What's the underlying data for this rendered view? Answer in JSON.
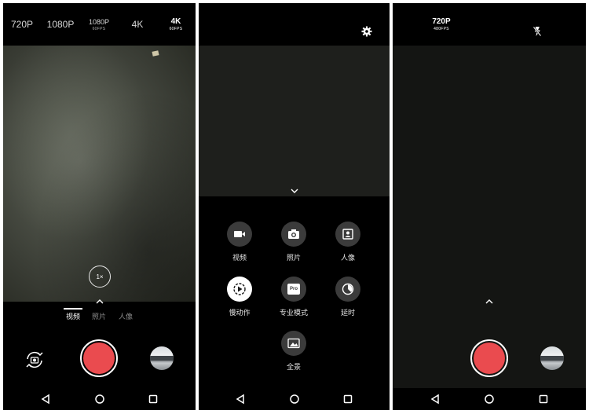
{
  "panel1": {
    "resolutions": [
      {
        "main": "720P",
        "sub": ""
      },
      {
        "main": "1080P",
        "sub": ""
      },
      {
        "main": "1080P",
        "sub": "60FPS"
      },
      {
        "main": "4K",
        "sub": ""
      },
      {
        "main": "4K",
        "sub": "60FPS"
      }
    ],
    "zoom_label": "1×",
    "modes": [
      "视频",
      "照片",
      "人像"
    ]
  },
  "panel2": {
    "modes": [
      {
        "label": "视频",
        "icon": "video-icon"
      },
      {
        "label": "照片",
        "icon": "camera-icon"
      },
      {
        "label": "人像",
        "icon": "portrait-icon"
      },
      {
        "label": "慢动作",
        "icon": "slow-motion-icon"
      },
      {
        "label": "专业模式",
        "icon": "pro-icon"
      },
      {
        "label": "延时",
        "icon": "timelapse-icon"
      },
      {
        "label": "全景",
        "icon": "panorama-icon"
      }
    ],
    "pro_badge": "Pro"
  },
  "panel3": {
    "resolution_main": "720P",
    "resolution_sub": "480FPS"
  },
  "colors": {
    "shutter": "#ea4b4f",
    "mode_circle": "#3b3b3b",
    "active_mode": "#ffffff"
  }
}
